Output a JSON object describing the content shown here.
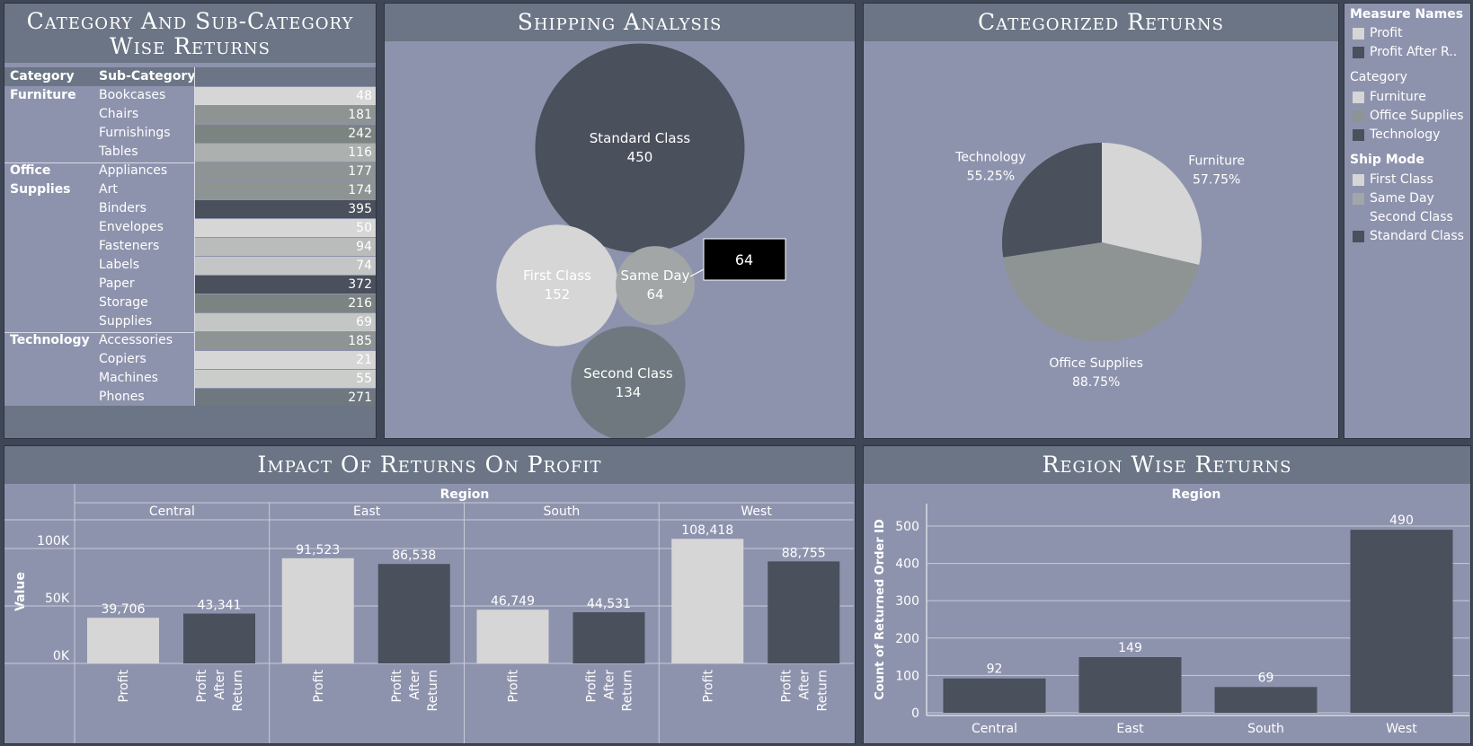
{
  "panels": {
    "category_table_title": "Category And Sub-Category Wise Returns",
    "shipping_title": "Shipping Analysis",
    "categorized_title": "Categorized Returns",
    "impact_title": "Impact Of Returns On Profit",
    "region_title": "Region Wise Returns"
  },
  "colors": {
    "panel_bg": "#8e93ad",
    "title_bg": "#6b7585",
    "dark": "#4a505c",
    "light": "#d6d6d6",
    "mid": "#8d9493",
    "slate": "#6e787e",
    "highlight_text": "#ffffff"
  },
  "legend": {
    "measure_names_title": "Measure Names",
    "measure_names": [
      {
        "label": "Profit",
        "color": "#d6d6d6"
      },
      {
        "label": "Profit After R..",
        "color": "#4a505c"
      }
    ],
    "category_title": "Category",
    "category": [
      {
        "label": "Furniture",
        "color": "#d6d6d6"
      },
      {
        "label": "Office Supplies",
        "color": "#8d9493"
      },
      {
        "label": "Technology",
        "color": "#4a505c"
      }
    ],
    "ship_mode_title": "Ship Mode",
    "ship_mode": [
      {
        "label": "First Class",
        "color": "#d6d6d6"
      },
      {
        "label": "Same Day",
        "color": "#a2a6a7"
      },
      {
        "label": "Second Class",
        "color": "#8e93ad"
      },
      {
        "label": "Standard Class",
        "color": "#4a505c"
      }
    ]
  },
  "chart_data": [
    {
      "type": "table",
      "title": "Category And Sub-Category Wise Returns",
      "columns": [
        "Category",
        "Sub-Category"
      ],
      "groups": [
        {
          "category": "Furniture",
          "rows": [
            {
              "sub": "Bookcases",
              "value": 48,
              "color": "#d6d6d6"
            },
            {
              "sub": "Chairs",
              "value": 181,
              "color": "#8d9493"
            },
            {
              "sub": "Furnishings",
              "value": 242,
              "color": "#7c8482"
            },
            {
              "sub": "Tables",
              "value": 116,
              "color": "#acb0ae"
            }
          ]
        },
        {
          "category": "Office Supplies",
          "rows": [
            {
              "sub": "Appliances",
              "value": 177,
              "color": "#8d9493"
            },
            {
              "sub": "Art",
              "value": 174,
              "color": "#8d9493"
            },
            {
              "sub": "Binders",
              "value": 395,
              "color": "#4a505c"
            },
            {
              "sub": "Envelopes",
              "value": 50,
              "color": "#d6d6d6"
            },
            {
              "sub": "Fasteners",
              "value": 94,
              "color": "#b9bcba"
            },
            {
              "sub": "Labels",
              "value": 74,
              "color": "#c3c6c4"
            },
            {
              "sub": "Paper",
              "value": 372,
              "color": "#4a505c"
            },
            {
              "sub": "Storage",
              "value": 216,
              "color": "#7c8482"
            },
            {
              "sub": "Supplies",
              "value": 69,
              "color": "#c3c6c4"
            }
          ]
        },
        {
          "category": "Technology",
          "rows": [
            {
              "sub": "Accessories",
              "value": 185,
              "color": "#8d9493"
            },
            {
              "sub": "Copiers",
              "value": 21,
              "color": "#d6d6d6"
            },
            {
              "sub": "Machines",
              "value": 55,
              "color": "#cbcdcb"
            },
            {
              "sub": "Phones",
              "value": 271,
              "color": "#6e787e"
            }
          ]
        }
      ]
    },
    {
      "type": "bubble",
      "title": "Shipping Analysis",
      "items": [
        {
          "label": "Standard Class",
          "value": 450,
          "color": "#4a505c"
        },
        {
          "label": "First Class",
          "value": 152,
          "color": "#d6d6d6"
        },
        {
          "label": "Same Day",
          "value": 64,
          "color": "#a2a6a7"
        },
        {
          "label": "Second Class",
          "value": 134,
          "color": "#6e787e"
        }
      ],
      "tooltip": "64"
    },
    {
      "type": "pie",
      "title": "Categorized Returns",
      "slices": [
        {
          "label": "Furniture",
          "pct": "57.75%",
          "weight": 57.75,
          "color": "#d6d6d6"
        },
        {
          "label": "Office Supplies",
          "pct": "88.75%",
          "weight": 88.75,
          "color": "#8d9493"
        },
        {
          "label": "Technology",
          "pct": "55.25%",
          "weight": 55.25,
          "color": "#4a505c"
        }
      ]
    },
    {
      "type": "bar",
      "title": "Impact Of Returns On Profit",
      "header": "Region",
      "ylabel": "Value",
      "yticks": [
        {
          "v": 0,
          "label": "0K"
        },
        {
          "v": 50000,
          "label": "50K"
        },
        {
          "v": 100000,
          "label": "100K"
        }
      ],
      "ylim": [
        0,
        125000
      ],
      "series_names": [
        "Profit",
        "Profit After Return"
      ],
      "groups": [
        {
          "region": "Central",
          "values": [
            39706,
            43341
          ],
          "labels": [
            "39,706",
            "43,341"
          ]
        },
        {
          "region": "East",
          "values": [
            91523,
            86538
          ],
          "labels": [
            "91,523",
            "86,538"
          ]
        },
        {
          "region": "South",
          "values": [
            46749,
            44531
          ],
          "labels": [
            "46,749",
            "44,531"
          ]
        },
        {
          "region": "West",
          "values": [
            108418,
            88755
          ],
          "labels": [
            "108,418",
            "88,755"
          ]
        }
      ]
    },
    {
      "type": "bar",
      "title": "Region Wise Returns",
      "header": "Region",
      "ylabel": "Count of Returned Order ID",
      "yticks": [
        0,
        100,
        200,
        300,
        400,
        500
      ],
      "ylim": [
        0,
        560
      ],
      "categories": [
        "Central",
        "East",
        "South",
        "West"
      ],
      "values": [
        92,
        149,
        69,
        490
      ]
    }
  ]
}
